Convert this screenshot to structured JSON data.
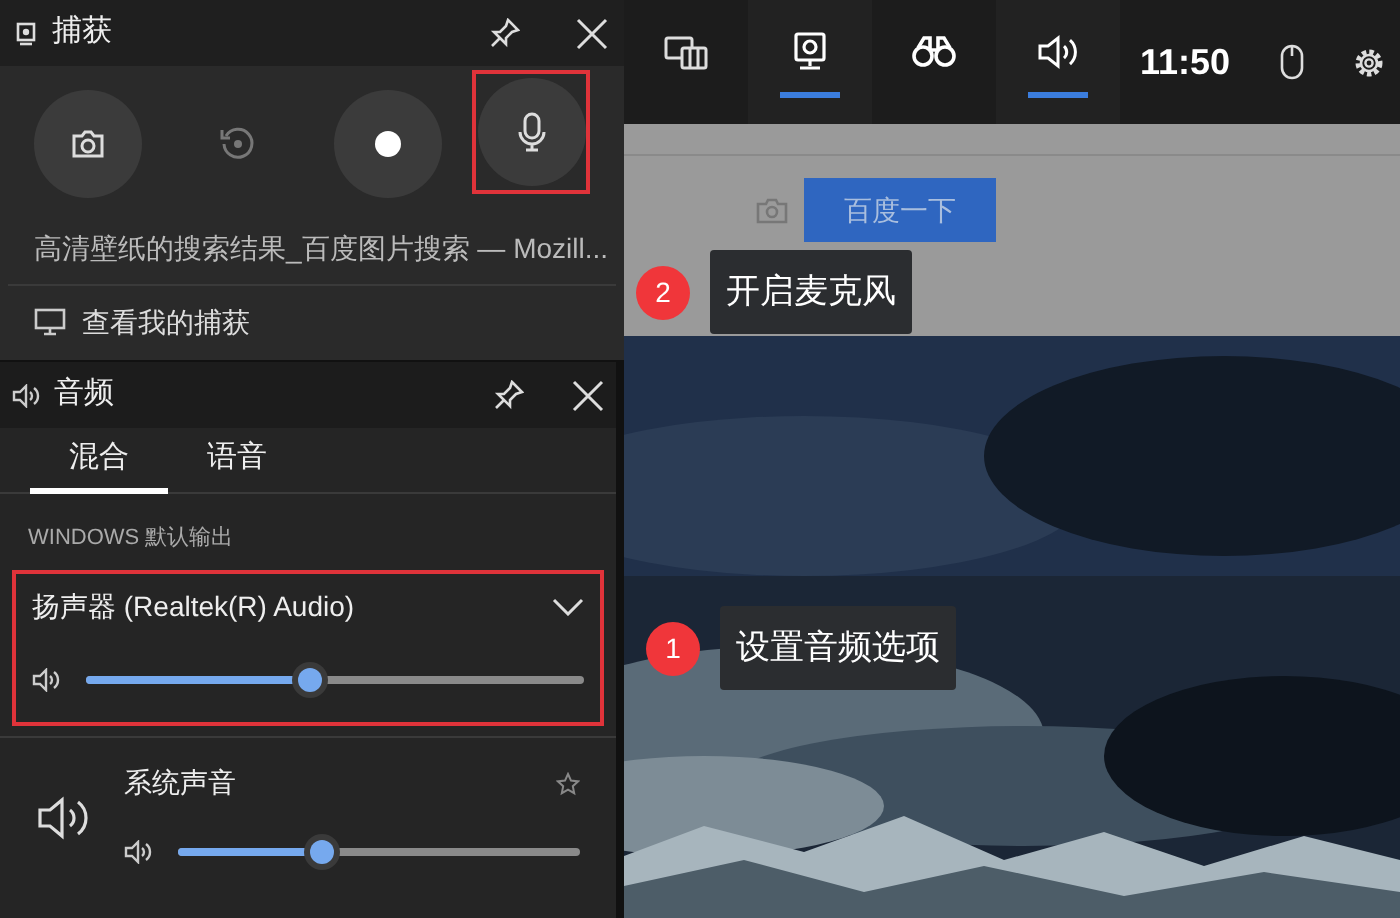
{
  "capture": {
    "title": "捕获",
    "buttons": [
      {
        "kind": "screenshot",
        "disabled": false
      },
      {
        "kind": "record_last",
        "disabled": true
      },
      {
        "kind": "record",
        "disabled": false
      },
      {
        "kind": "mic",
        "disabled": false
      }
    ],
    "window_title": "高清壁纸的搜索结果_百度图片搜索 — Mozill...",
    "link": "查看我的捕获"
  },
  "top_bar": {
    "widgets": [
      {
        "kind": "widgets",
        "selected": false
      },
      {
        "kind": "capture",
        "selected": true
      },
      {
        "kind": "performance",
        "selected": false
      },
      {
        "kind": "audio",
        "selected": true
      }
    ],
    "time": "11:50"
  },
  "browser": {
    "search_button": "百度一下"
  },
  "audio": {
    "title": "音频",
    "tabs": [
      {
        "label": "混合",
        "selected": true
      },
      {
        "label": "语音",
        "selected": false
      }
    ],
    "section": "WINDOWS 默认输出",
    "device": "扬声器 (Realtek(R) Audio)",
    "master": {
      "level": 0.45
    },
    "apps": [
      {
        "name": "系统声音",
        "level": 0.36
      }
    ]
  },
  "callouts": [
    {
      "number": "2",
      "text": "开启麦克风"
    },
    {
      "number": "1",
      "text": "设置音频选项"
    }
  ]
}
